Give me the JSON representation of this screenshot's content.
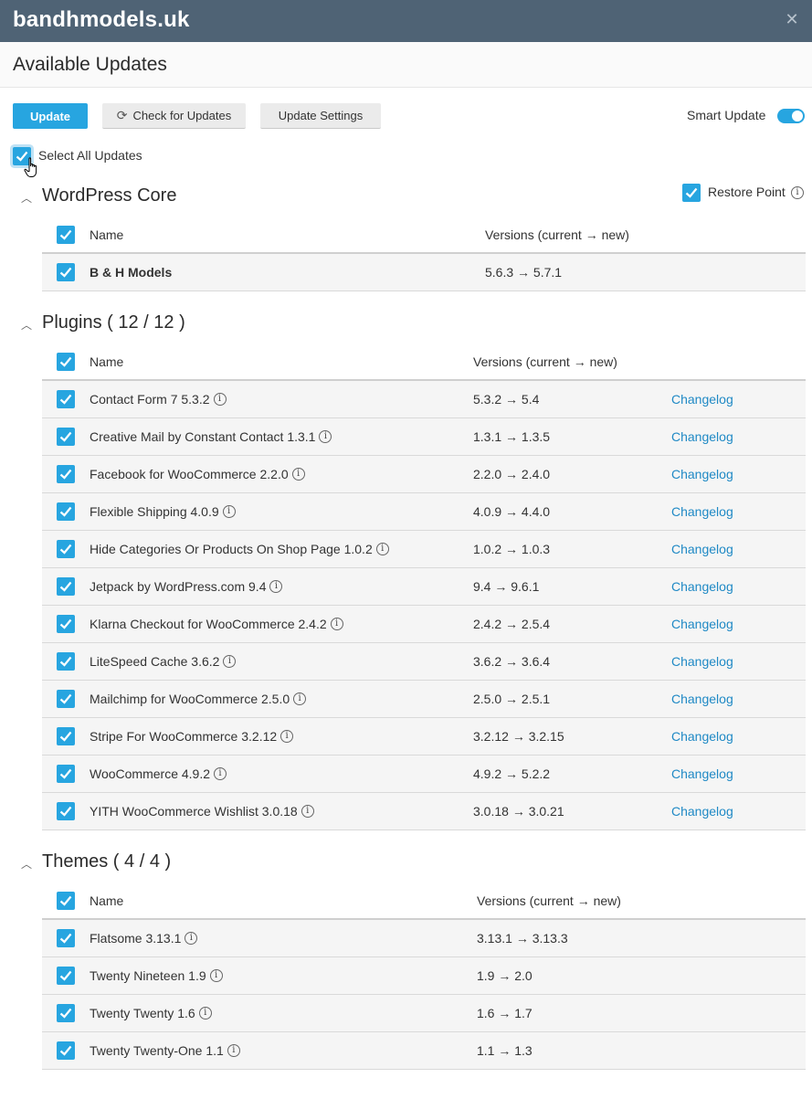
{
  "window": {
    "title": "bandhmodels.uk"
  },
  "page": {
    "title": "Available Updates"
  },
  "toolbar": {
    "update_label": "Update",
    "check_label": "Check for Updates",
    "settings_label": "Update Settings",
    "smart_update_label": "Smart Update",
    "smart_update_on": true
  },
  "select_all": {
    "label": "Select All Updates",
    "checked": true
  },
  "core": {
    "title": "WordPress Core",
    "restore_label": "Restore Point",
    "col_name": "Name",
    "col_versions": "Versions (current → new)",
    "rows": [
      {
        "name": "B & H Models",
        "versions": "5.6.3 → 5.7.1"
      }
    ]
  },
  "plugins": {
    "title": "Plugins ( 12 / 12 )",
    "col_name": "Name",
    "col_versions": "Versions (current → new)",
    "changelog_label": "Changelog",
    "rows": [
      {
        "name": "Contact Form 7 5.3.2",
        "versions": "5.3.2 → 5.4"
      },
      {
        "name": "Creative Mail by Constant Contact 1.3.1",
        "versions": "1.3.1 → 1.3.5"
      },
      {
        "name": "Facebook for WooCommerce 2.2.0",
        "versions": "2.2.0 → 2.4.0"
      },
      {
        "name": "Flexible Shipping 4.0.9",
        "versions": "4.0.9 → 4.4.0"
      },
      {
        "name": "Hide Categories Or Products On Shop Page 1.0.2",
        "versions": "1.0.2 → 1.0.3"
      },
      {
        "name": "Jetpack by WordPress.com 9.4",
        "versions": "9.4 → 9.6.1"
      },
      {
        "name": "Klarna Checkout for WooCommerce 2.4.2",
        "versions": "2.4.2 → 2.5.4"
      },
      {
        "name": "LiteSpeed Cache 3.6.2",
        "versions": "3.6.2 → 3.6.4"
      },
      {
        "name": "Mailchimp for WooCommerce 2.5.0",
        "versions": "2.5.0 → 2.5.1"
      },
      {
        "name": "Stripe For WooCommerce 3.2.12",
        "versions": "3.2.12 → 3.2.15"
      },
      {
        "name": "WooCommerce 4.9.2",
        "versions": "4.9.2 → 5.2.2"
      },
      {
        "name": "YITH WooCommerce Wishlist 3.0.18",
        "versions": "3.0.18 → 3.0.21"
      }
    ]
  },
  "themes": {
    "title": "Themes ( 4 / 4 )",
    "col_name": "Name",
    "col_versions": "Versions (current → new)",
    "rows": [
      {
        "name": "Flatsome 3.13.1",
        "versions": "3.13.1 → 3.13.3"
      },
      {
        "name": "Twenty Nineteen 1.9",
        "versions": "1.9 → 2.0"
      },
      {
        "name": "Twenty Twenty 1.6",
        "versions": "1.6 → 1.7"
      },
      {
        "name": "Twenty Twenty-One 1.1",
        "versions": "1.1 → 1.3"
      }
    ]
  },
  "icons": {
    "close": "close-icon",
    "refresh": "refresh-icon",
    "collapse": "chevron-up-icon",
    "info": "info-icon",
    "check": "checkmark-icon",
    "cursor": "hand-pointer-icon"
  },
  "colors": {
    "accent": "#27a5e0",
    "titlebar": "#4f6375",
    "link": "#1f89c5"
  }
}
